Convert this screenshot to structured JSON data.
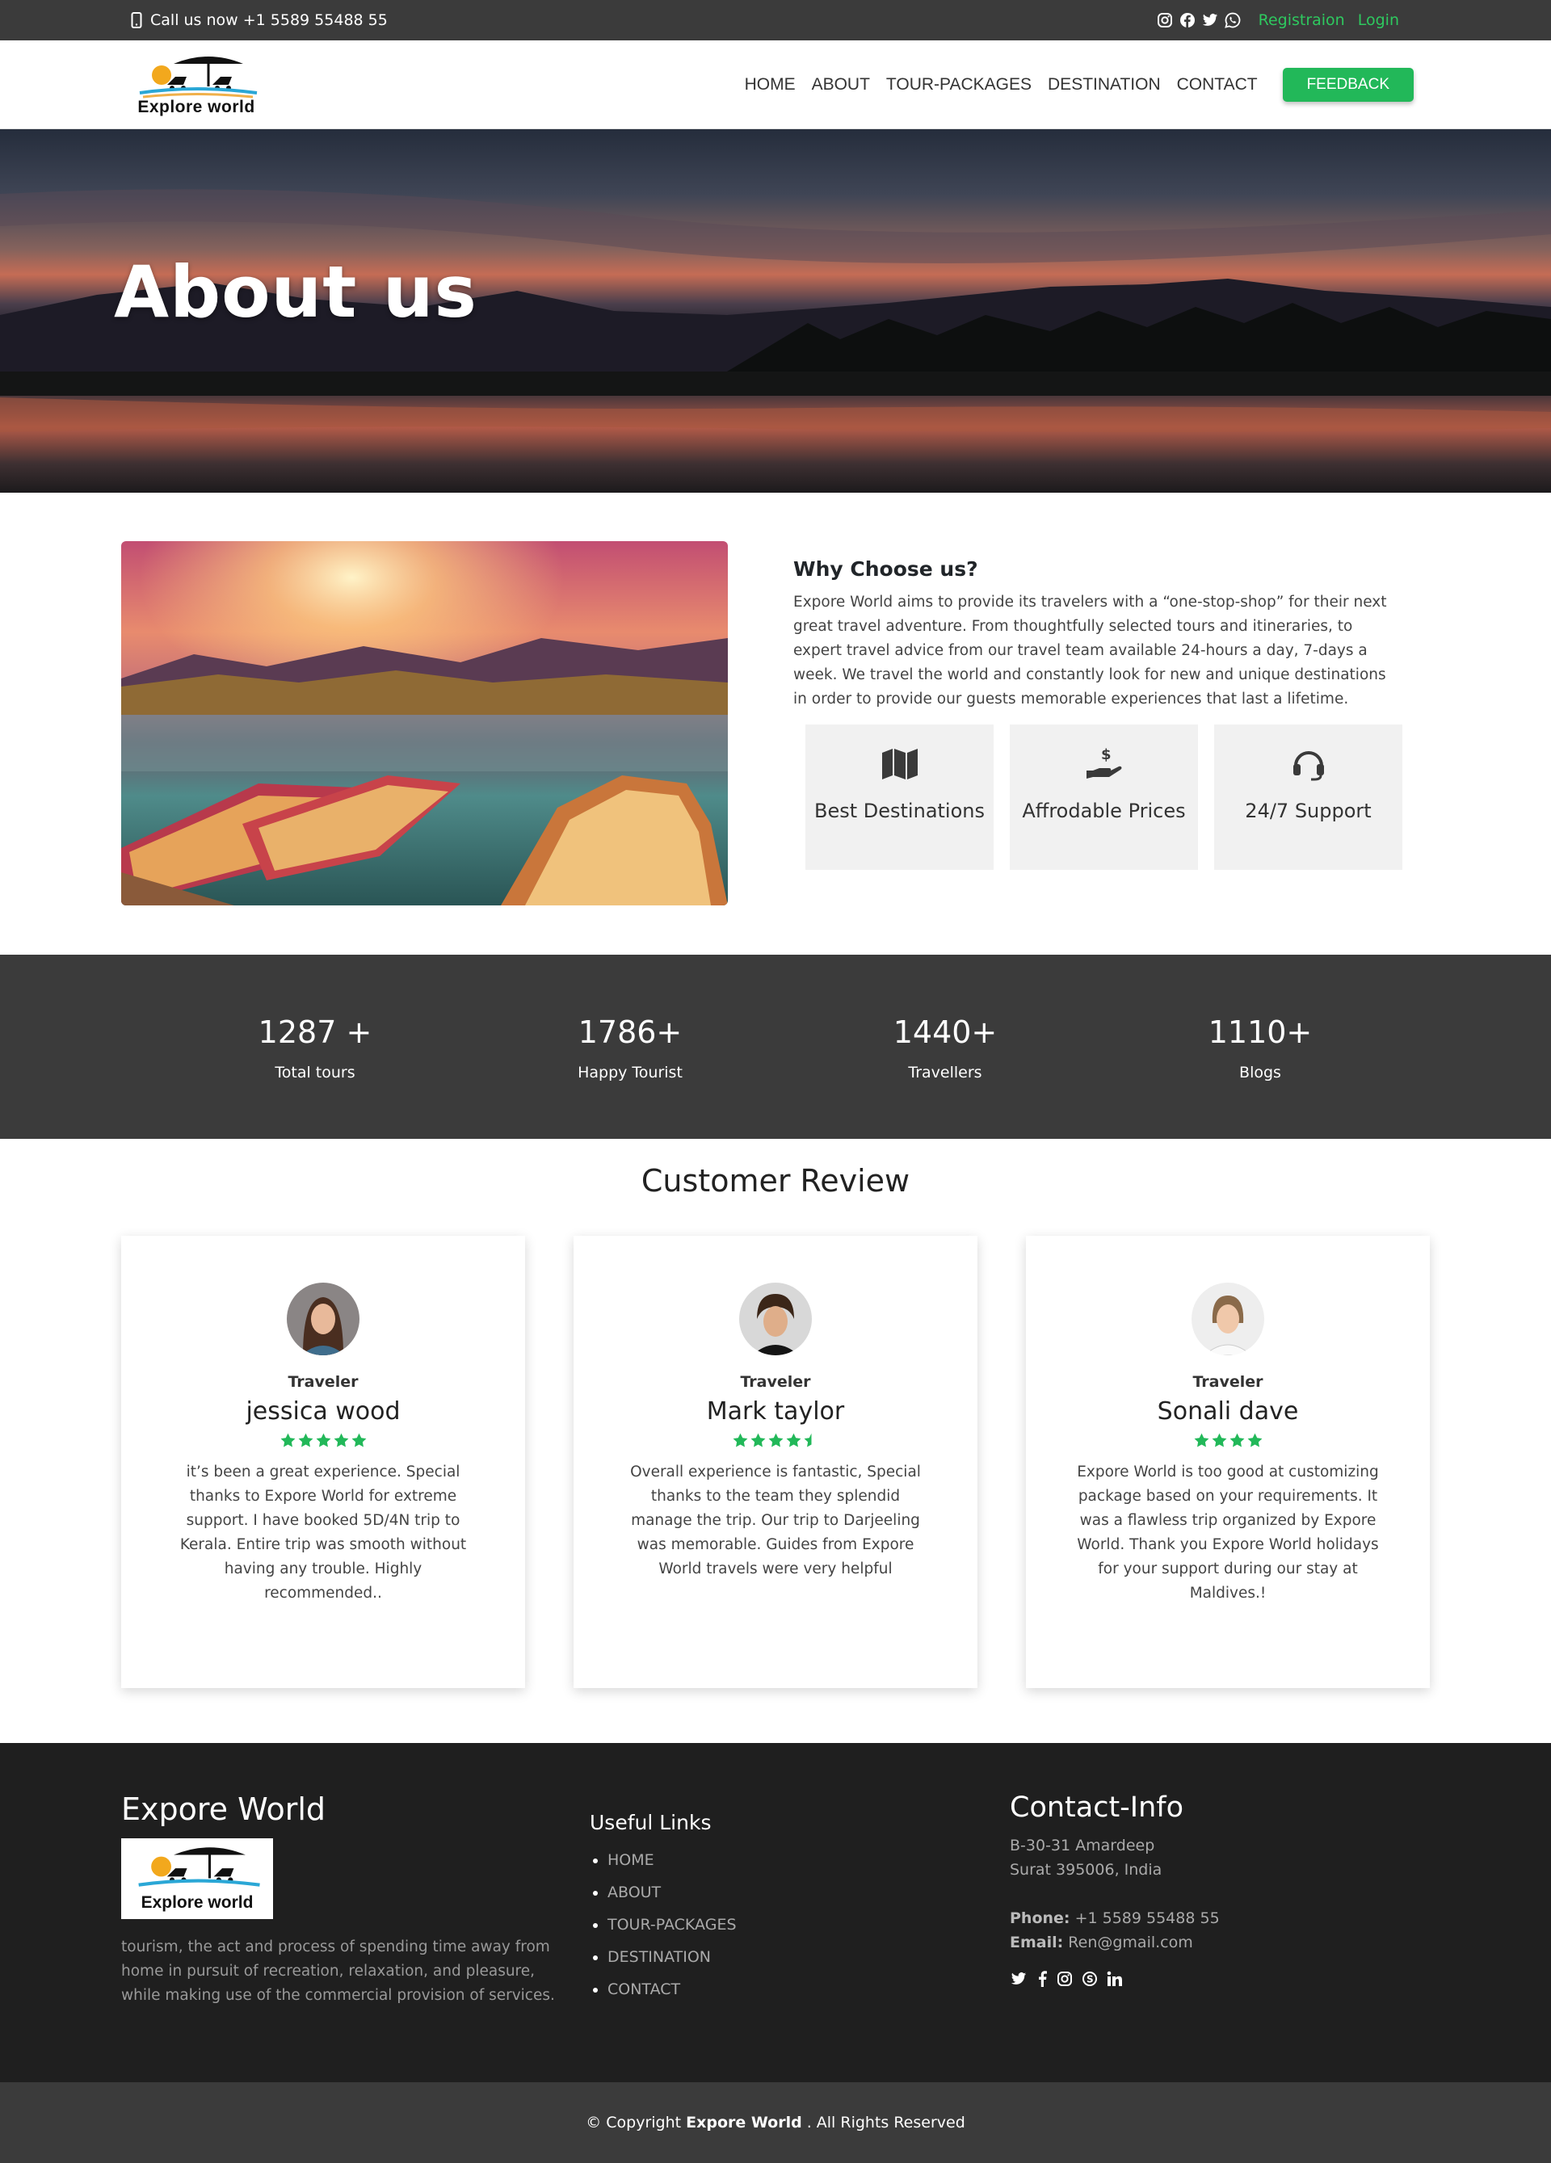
{
  "topbar": {
    "phone_text": "Call us now +1 5589 55488 55",
    "social_icons": [
      "instagram-icon",
      "facebook-icon",
      "twitter-icon",
      "whatsapp-icon"
    ],
    "register_label": "Registraion",
    "login_label": "Login",
    "link_color": "#2ec95f"
  },
  "nav": {
    "logo_text": "Explore world",
    "items": [
      "HOME",
      "ABOUT",
      "TOUR-PACKAGES",
      "DESTINATION",
      "CONTACT"
    ],
    "feedback_label": "FEEDBACK",
    "accent_color": "#22b859"
  },
  "hero": {
    "title": "About us"
  },
  "why": {
    "heading": "Why Choose us?",
    "paragraph": "Expore World aims to provide its travelers with a “one-stop-shop” for their next great travel adventure. From thoughtfully selected tours and itineraries, to expert travel advice from our travel team available 24-hours a day, 7-days a week. We travel the world and constantly look for new and unique destinations in order to provide our guests memorable experiences that last a lifetime.",
    "features": [
      {
        "icon": "map-icon",
        "label": "Best Destinations"
      },
      {
        "icon": "hand-dollar-icon",
        "label": "Affrodable Prices"
      },
      {
        "icon": "headset-icon",
        "label": "24/7 Support"
      }
    ]
  },
  "stats": [
    {
      "number": "1287 +",
      "label": "Total tours"
    },
    {
      "number": "1786+",
      "label": "Happy Tourist"
    },
    {
      "number": "1440+",
      "label": "Travellers"
    },
    {
      "number": "1110+",
      "label": "Blogs"
    }
  ],
  "reviews": {
    "heading": "Customer Review",
    "items": [
      {
        "role": "Traveler",
        "name": "jessica wood",
        "rating": 5,
        "text": "it’s been a great experience. Special thanks to Expore World for extreme support. I have booked 5D/4N trip to Kerala. Entire trip was smooth without having any trouble. Highly recommended.."
      },
      {
        "role": "Traveler",
        "name": "Mark taylor",
        "rating": 4.5,
        "text": "Overall experience is fantastic, Special thanks to the team they splendid manage the trip. Our trip to Darjeeling was memorable. Guides from Expore World travels were very helpful"
      },
      {
        "role": "Traveler",
        "name": "Sonali dave",
        "rating": 4,
        "text": "Expore World is too good at customizing package based on your requirements. It was a flawless trip organized by Expore World. Thank you Expore World holidays for your support during our stay at Maldives.!"
      }
    ],
    "star_color": "#22b859"
  },
  "footer": {
    "brand": "Expore World",
    "logo_text": "Explore world",
    "description": "tourism, the act and process of spending time away from home in pursuit of recreation, relaxation, and pleasure, while making use of the commercial provision of services.",
    "links_heading": "Useful Links",
    "links": [
      "HOME",
      "ABOUT",
      "TOUR-PACKAGES",
      "DESTINATION",
      "CONTACT"
    ],
    "contact_heading": "Contact-Info",
    "address_line1": "B-30-31 Amardeep",
    "address_line2": "Surat 395006, India",
    "phone_label": "Phone:",
    "phone": "+1 5589 55488 55",
    "email_label": "Email:",
    "email": "Ren@gmail.com",
    "social_icons": [
      "twitter-icon",
      "facebook-icon",
      "instagram-icon",
      "skype-icon",
      "linkedin-icon"
    ]
  },
  "copyright": {
    "prefix": "© Copyright",
    "brand": "Expore World",
    "suffix": ". All Rights Reserved"
  }
}
